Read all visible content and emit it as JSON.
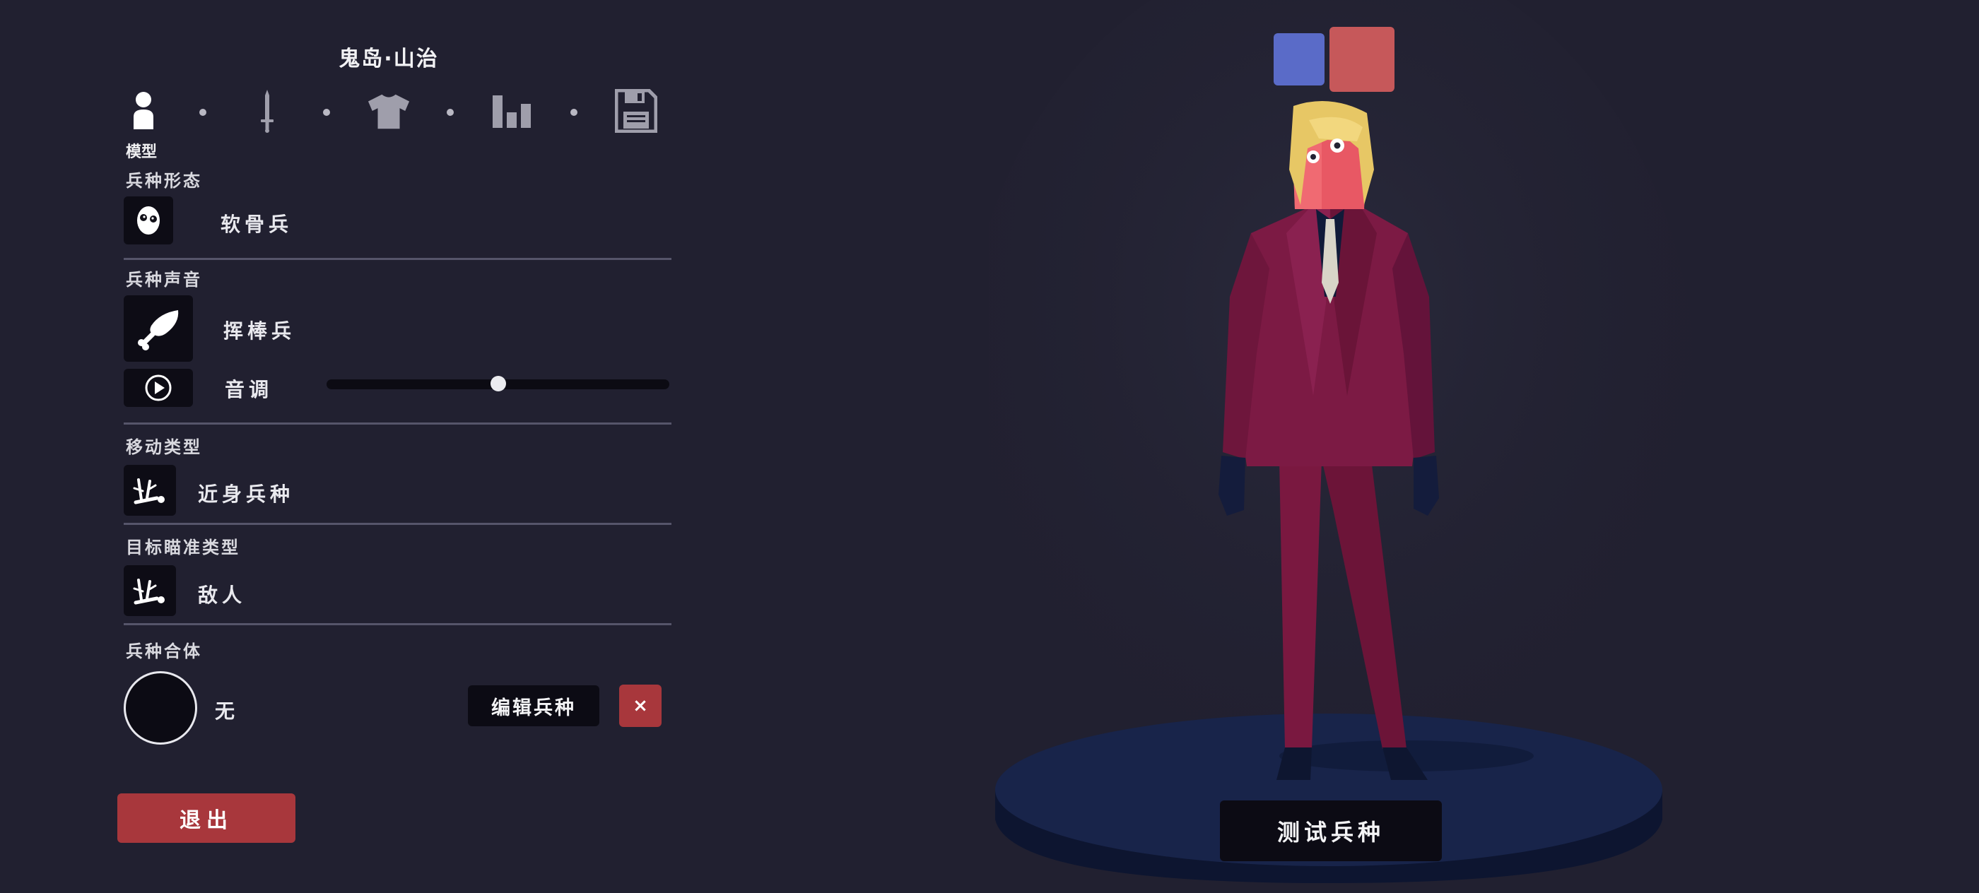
{
  "unit_name": "鬼岛·山治",
  "tabs": [
    {
      "name": "model",
      "icon": "person-icon",
      "active": true
    },
    {
      "name": "weapon",
      "icon": "sword-icon",
      "active": false
    },
    {
      "name": "clothing",
      "icon": "shirt-icon",
      "active": false
    },
    {
      "name": "stats",
      "icon": "bar-chart-icon",
      "active": false
    },
    {
      "name": "save",
      "icon": "floppy-disk-icon",
      "active": false
    }
  ],
  "active_tab_label": "模型",
  "sections": {
    "form": {
      "label": "兵种形态",
      "value": "软骨兵",
      "icon": "ragdoll-face-icon"
    },
    "voice": {
      "label": "兵种声音",
      "value": "挥棒兵",
      "icon": "drumstick-icon",
      "pitch_label": "音调",
      "pitch_value": 0.5,
      "play_icon": "play-icon"
    },
    "movement": {
      "label": "移动类型",
      "value": "近身兵种",
      "icon": "melee-icon"
    },
    "targeting": {
      "label": "目标瞄准类型",
      "value": "敌人",
      "icon": "melee-icon"
    },
    "mount": {
      "label": "兵种合体",
      "value": "无",
      "edit_label": "编辑兵种",
      "remove_label": "×"
    }
  },
  "exit_label": "退出",
  "test_label": "测试兵种",
  "team_colors": {
    "blue": "#5a6bc8",
    "red": "#c6585a"
  },
  "accent_colors": {
    "danger": "#a8373c",
    "background": "#212030",
    "panel": "#0c0b14"
  }
}
